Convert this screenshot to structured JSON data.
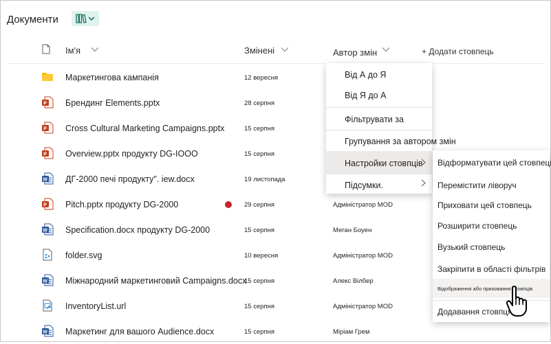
{
  "header": {
    "title": "Документи"
  },
  "columns": {
    "name": "Ім'я",
    "modified": "Змінені",
    "author": "Автор змін",
    "add_column": "+ Додати стовпець"
  },
  "rows": [
    {
      "icon": "folder-icon",
      "name": "Маркетингова кампанія",
      "date": "12 вересня",
      "author": ""
    },
    {
      "icon": "powerpoint-file-icon",
      "name": "Брендинг Elements.pptx",
      "date": "28 серпня",
      "author": ""
    },
    {
      "icon": "powerpoint-file-icon",
      "name": "Cross Cultural Marketing Campaigns.pptx",
      "date": "15 серпня",
      "author": ""
    },
    {
      "icon": "powerpoint-file-icon",
      "name": "Overview.pptx продукту DG-IOOO",
      "date": "15 серпня",
      "author": ""
    },
    {
      "icon": "word-file-icon",
      "name": "ДГ-2000 печі продукту\". iew.docx",
      "date": "19 листопада",
      "author": ""
    },
    {
      "icon": "powerpoint-file-icon",
      "name": "Pitch.pptx продукту DG-2000",
      "date": "29 серпня",
      "author": "Адміністратор MOD"
    },
    {
      "icon": "word-file-icon",
      "name": "Specification.docx продукту DG-2000",
      "date": "15 серпня",
      "author": "Меган Боуен"
    },
    {
      "icon": "svg-file-icon",
      "name": "folder.svg",
      "date": "10 вересня",
      "author": "Адміністратор MOD"
    },
    {
      "icon": "word-file-icon",
      "name": "Міжнародний маркетинговий Campaigns.docx",
      "date": "15 серпня",
      "author": "Алекс Вілбер"
    },
    {
      "icon": "url-file-icon",
      "name": "InventoryList.url",
      "date": "15 серпня",
      "author": "Адміністратор MOD"
    },
    {
      "icon": "word-file-icon",
      "name": "Маркетинг для вашого Audience.docx",
      "date": "15 серпня",
      "author": "Міріам Грем"
    }
  ],
  "column_menu": {
    "sort_az": "Від А до Я",
    "sort_za": "Від Я до А",
    "filter_by": "Фільтрувати за",
    "group_by": "Групування за автором змін",
    "column_settings": "Настройки стовпців",
    "totals": "Підсумки."
  },
  "settings_submenu": {
    "format": "Відформатувати цей стовпець",
    "move_left": "Перемістити ліворуч",
    "hide": "Приховати цей стовпець",
    "widen": "Розширити стовпець",
    "narrow": "Вузький стовпець",
    "pin_filters": "Закріпити в області фільтрів",
    "show_hide": "Відображення або приховання стовпців",
    "add_column": "Додавання стовпця"
  },
  "colors": {
    "accent_view": "#dff3ee",
    "powerpoint": "#c43e1c",
    "word": "#2b579a",
    "folder": "#ffb900",
    "flag": "#c4262e"
  }
}
